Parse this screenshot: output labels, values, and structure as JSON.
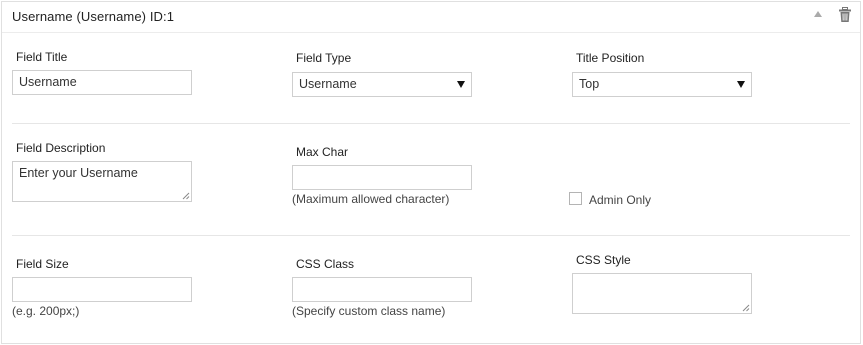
{
  "header": {
    "title": "Username (Username) ID:1",
    "collapse_icon": "triangle-up-icon",
    "delete_icon": "trash-icon"
  },
  "row1": {
    "field_title": {
      "label": "Field Title",
      "value": "Username"
    },
    "field_type": {
      "label": "Field Type",
      "selected": "Username"
    },
    "title_position": {
      "label": "Title Position",
      "selected": "Top"
    }
  },
  "row2": {
    "field_description": {
      "label": "Field Description",
      "value": "Enter your Username"
    },
    "max_char": {
      "label": "Max Char",
      "value": "",
      "hint": "(Maximum allowed character)"
    },
    "admin_only": {
      "label": "Admin Only",
      "checked": false
    }
  },
  "row3": {
    "field_size": {
      "label": "Field Size",
      "value": "",
      "hint": "(e.g. 200px;)"
    },
    "css_class": {
      "label": "CSS Class",
      "value": "",
      "hint": "(Specify custom class name)"
    },
    "css_style": {
      "label": "CSS Style",
      "value": ""
    }
  },
  "colors": {
    "border": "#cfcfcf",
    "divider": "#e6e6e6",
    "text": "#222222"
  }
}
